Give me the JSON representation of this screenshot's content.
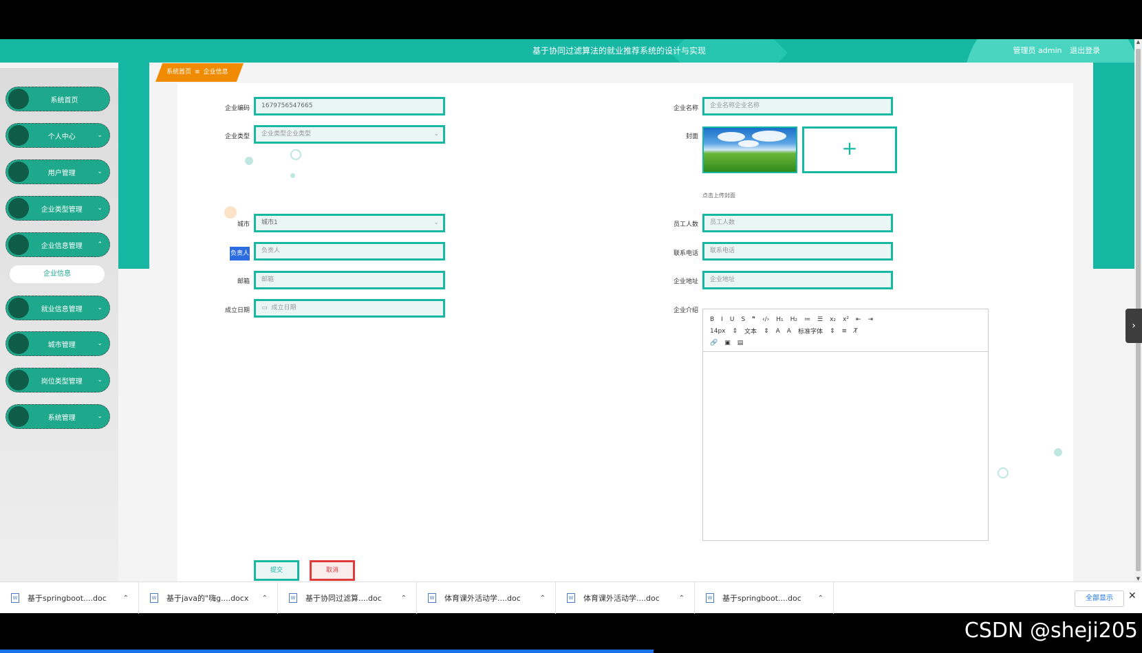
{
  "header": {
    "title": "基于协同过滤算法的就业推荐系统的设计与实现",
    "user": "管理员 admin",
    "logout": "退出登录"
  },
  "breadcrumb": {
    "home": "系统首页",
    "separator": "≡",
    "current": "企业信息"
  },
  "sidebar": {
    "items": [
      {
        "label": "系统首页",
        "chevron": ""
      },
      {
        "label": "个人中心",
        "chevron": "⌄"
      },
      {
        "label": "用户管理",
        "chevron": "⌄"
      },
      {
        "label": "企业类型管理",
        "chevron": "⌄"
      },
      {
        "label": "企业信息管理",
        "chevron": "⌃"
      },
      {
        "label": "就业信息管理",
        "chevron": "⌄"
      },
      {
        "label": "城市管理",
        "chevron": "⌄"
      },
      {
        "label": "岗位类型管理",
        "chevron": "⌄"
      },
      {
        "label": "系统管理",
        "chevron": "⌄"
      }
    ],
    "sub_item": "企业信息"
  },
  "form": {
    "code": {
      "label": "企业编码",
      "value": "1679756547665"
    },
    "name": {
      "label": "企业名称",
      "placeholder": "企业名称企业名称"
    },
    "type": {
      "label": "企业类型",
      "placeholder": "企业类型企业类型"
    },
    "cover": {
      "label": "封面",
      "add": "+",
      "hint": "点击上传封面"
    },
    "city": {
      "label": "城市",
      "value": "城市1"
    },
    "staff": {
      "label": "员工人数",
      "placeholder": "员工人数"
    },
    "owner": {
      "label": "负责人",
      "placeholder": "负责人"
    },
    "phone": {
      "label": "联系电话",
      "placeholder": "联系电话"
    },
    "email": {
      "label": "邮箱",
      "placeholder": "邮箱"
    },
    "address": {
      "label": "企业地址",
      "placeholder": "企业地址"
    },
    "date": {
      "label": "成立日期",
      "placeholder": "成立日期",
      "icon": "▭"
    },
    "intro": {
      "label": "企业介绍"
    },
    "select_arrow": "⌄"
  },
  "editor": {
    "row1": [
      "B",
      "I",
      "U",
      "S",
      "❞",
      "‹/›",
      "H₁",
      "H₂",
      "≔",
      "☰",
      "x₂",
      "x²",
      "⇤",
      "⇥"
    ],
    "row2": [
      "14px",
      "⇕",
      "文本",
      "⇕",
      "A",
      "A",
      "标准字体",
      "⇕",
      "≡",
      "T̸"
    ],
    "row3": [
      "🔗",
      "▣",
      "▤"
    ]
  },
  "buttons": {
    "submit": "提交",
    "cancel": "取消"
  },
  "downloads": {
    "items": [
      "基于springboot....doc",
      "基于java的\"嗨g....docx",
      "基于协同过滤算....doc",
      "体育课外活动学....doc",
      "体育课外活动学....doc",
      "基于springboot....doc"
    ],
    "show_all": "全部显示",
    "close": "✕"
  },
  "watermark": "CSDN @sheji205",
  "colors": {
    "primary": "#16b8a4",
    "accent": "#f08a00",
    "danger": "#e03b3b"
  }
}
